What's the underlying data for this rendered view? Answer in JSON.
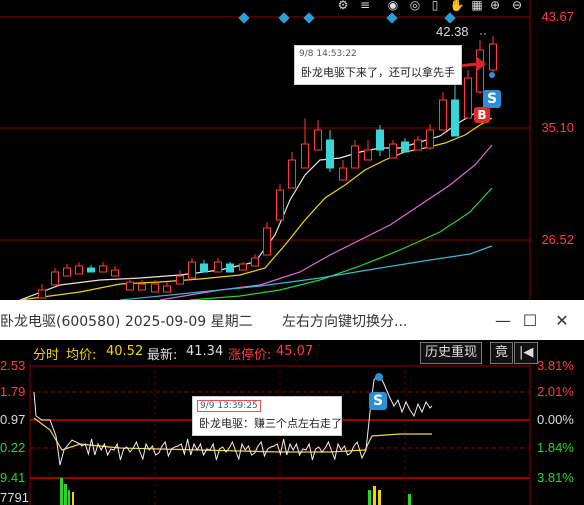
{
  "kchart": {
    "price_labels": [
      "43.67",
      "35.10",
      "26.52"
    ],
    "last_high_label": "42.38",
    "note": {
      "time": "9/8 14:53:22",
      "text": "卧龙电驱下来了，还可以拿先手"
    },
    "markers": {
      "sell": "S",
      "buy": "B"
    },
    "toolbar_icons": [
      "settings-icon",
      "eye-icon",
      "eye-icon",
      "trash-icon",
      "hand-icon",
      "zoom-in-icon",
      "zoom-out-icon"
    ]
  },
  "window": {
    "title": "卧龙电驱(600580) 2025-09-09 星期二",
    "hint": "左右方向键切换分...",
    "minimize": "—",
    "maximize": "☐",
    "close": "✕"
  },
  "intraday": {
    "label_fenshi": "分时",
    "label_avg": "均价:",
    "avg_value": "40.52",
    "label_latest": "最新:",
    "latest_value": "41.34",
    "label_limit": "涨停价:",
    "limit_value": "45.07",
    "replay_button": "历史重现",
    "bid_button": "竟",
    "prev_button": "|◀",
    "left_axis": [
      "2.53",
      "1.79",
      "0.97",
      "0.22",
      "9.41",
      "7791"
    ],
    "right_axis": [
      "3.81%",
      "2.01%",
      "0.00%",
      "1.84%",
      "3.81%"
    ],
    "note": {
      "time": "9/9 13:39:25",
      "text": "卧龙电驱：赚三个点左右走了"
    },
    "sell_marker": "S"
  },
  "colors": {
    "up": "#ff3b3b",
    "down": "#38d6d6",
    "accent_blue": "#2a8fd6"
  }
}
